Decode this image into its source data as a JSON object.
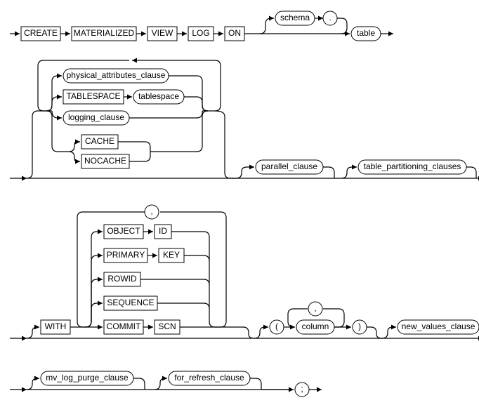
{
  "chart_data": {
    "type": "railroad-diagram",
    "title": "CREATE MATERIALIZED VIEW LOG syntax",
    "lines": [
      {
        "sequence": [
          "CREATE",
          "MATERIALIZED",
          "VIEW",
          "LOG",
          "ON"
        ],
        "optional": {
          "prefix": [
            "schema",
            "."
          ],
          "then": "table"
        }
      },
      {
        "optional_repeat": {
          "branches": [
            [
              "physical_attributes_clause"
            ],
            [
              "TABLESPACE",
              "tablespace"
            ],
            [
              "logging_clause"
            ],
            [
              {
                "choice": [
                  "CACHE",
                  "NOCACHE"
                ]
              }
            ]
          ]
        },
        "then_optional": [
          "parallel_clause"
        ],
        "then_optional2": [
          "table_partitioning_clauses"
        ]
      },
      {
        "optional": {
          "prefix": [
            "WITH"
          ],
          "repeat_sep": ",",
          "branches": [
            [
              "OBJECT",
              "ID"
            ],
            [
              "PRIMARY",
              "KEY"
            ],
            [
              "ROWID"
            ],
            [
              "SEQUENCE"
            ],
            [
              "COMMIT",
              "SCN"
            ]
          ],
          "then_optional_group": {
            "open": "(",
            "repeat_sep": ",",
            "item": "column",
            "close": ")"
          },
          "then_optional": [
            "new_values_clause"
          ]
        }
      },
      {
        "optional": [
          "mv_log_purge_clause"
        ],
        "optional2": [
          "for_refresh_clause"
        ],
        "terminator": ";"
      }
    ]
  },
  "tokens": {
    "create": "CREATE",
    "materialized": "MATERIALIZED",
    "view": "VIEW",
    "log": "LOG",
    "on": "ON",
    "schema": "schema",
    "dot": ".",
    "table": "table",
    "physical_attributes_clause": "physical_attributes_clause",
    "tablespace_kw": "TABLESPACE",
    "tablespace": "tablespace",
    "logging_clause": "logging_clause",
    "cache": "CACHE",
    "nocache": "NOCACHE",
    "parallel_clause": "parallel_clause",
    "table_partitioning_clauses": "table_partitioning_clauses",
    "with": "WITH",
    "object": "OBJECT",
    "id": "ID",
    "primary": "PRIMARY",
    "key": "KEY",
    "rowid": "ROWID",
    "sequence": "SEQUENCE",
    "commit": "COMMIT",
    "scn": "SCN",
    "comma": ",",
    "lparen": "(",
    "rparen": ")",
    "column": "column",
    "new_values_clause": "new_values_clause",
    "mv_log_purge_clause": "mv_log_purge_clause",
    "for_refresh_clause": "for_refresh_clause",
    "semicolon": ";"
  }
}
